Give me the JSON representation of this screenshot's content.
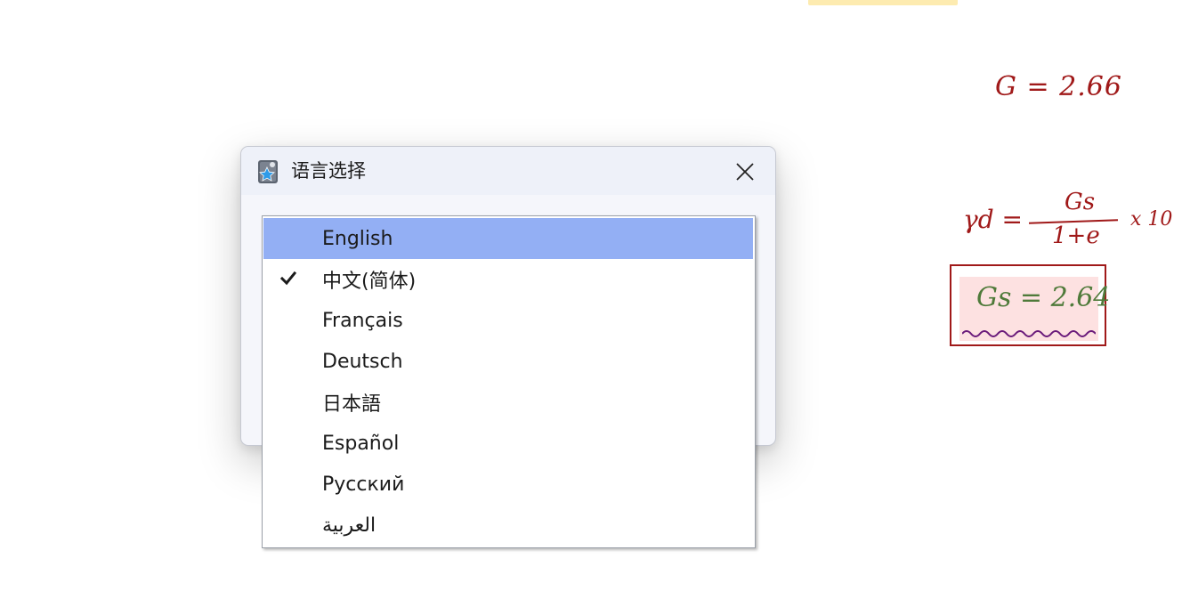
{
  "dialog": {
    "title": "语言选择",
    "close_icon": "close-icon",
    "app_icon": "app-star-icon"
  },
  "language_list": {
    "items": [
      {
        "label": "English",
        "highlighted": true,
        "checked": false
      },
      {
        "label": "中文(简体)",
        "highlighted": false,
        "checked": true
      },
      {
        "label": "Français",
        "highlighted": false,
        "checked": false
      },
      {
        "label": "Deutsch",
        "highlighted": false,
        "checked": false
      },
      {
        "label": "日本語",
        "highlighted": false,
        "checked": false
      },
      {
        "label": "Español",
        "highlighted": false,
        "checked": false
      },
      {
        "label": "Русский",
        "highlighted": false,
        "checked": false
      },
      {
        "label": "العربية",
        "highlighted": false,
        "checked": false
      }
    ],
    "highlight_color": "#93aff4"
  },
  "notes": {
    "g_value": "G = 2.66",
    "formula_lhs": "γd =",
    "formula_numerator": "Gs",
    "formula_denominator": "1+e",
    "formula_rhs": "x 10",
    "boxed_value": "Gs = 2.64",
    "ink_color": "#a01919",
    "boxed_text_color": "#4f7a3a"
  }
}
